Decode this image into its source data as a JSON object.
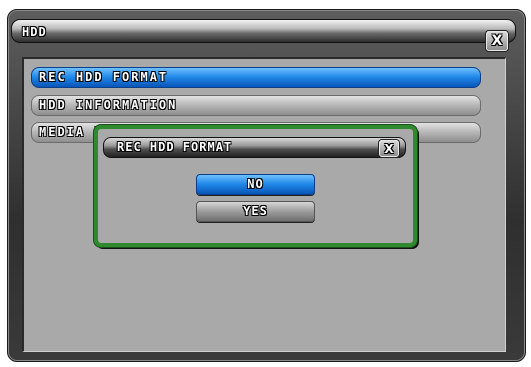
{
  "window": {
    "title": "HDD",
    "close_glyph": "X"
  },
  "menu": {
    "items": [
      {
        "label": "REC HDD FORMAT",
        "selected": true
      },
      {
        "label": "HDD INFORMATION",
        "selected": false
      },
      {
        "label": "MEDIA I",
        "selected": false
      }
    ]
  },
  "dialog": {
    "title": "REC HDD FORMAT",
    "close_glyph": "X",
    "buttons": [
      {
        "label": "NO",
        "selected": true
      },
      {
        "label": "YES",
        "selected": false
      }
    ]
  },
  "colors": {
    "selection_blue": "#1d86e6",
    "dialog_border_green": "#2f8a2f",
    "panel_gray": "#a9a9a9"
  }
}
